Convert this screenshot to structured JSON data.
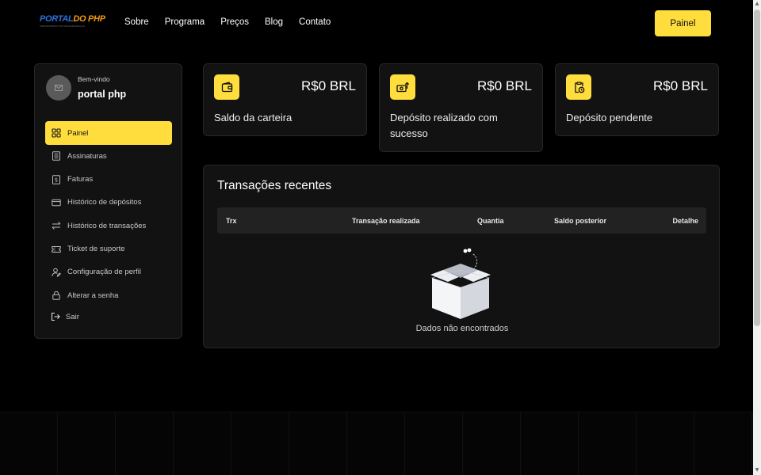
{
  "brand": {
    "logo_part1": "PORTAL",
    "logo_part2": "DO PHP",
    "logo_tagline": "TREINAMENTO EM PROGRAMAÇÃO"
  },
  "nav": {
    "items": [
      {
        "label": "Sobre"
      },
      {
        "label": "Programa"
      },
      {
        "label": "Preços"
      },
      {
        "label": "Blog"
      },
      {
        "label": "Contato"
      }
    ]
  },
  "header": {
    "cta_label": "Painel"
  },
  "user": {
    "welcome": "Bem-vindo",
    "name": "portal php"
  },
  "sidebar": {
    "items": [
      {
        "label": "Painel",
        "icon": "dashboard-icon",
        "active": true
      },
      {
        "label": "Assinaturas",
        "icon": "list-icon"
      },
      {
        "label": "Faturas",
        "icon": "invoice-icon"
      },
      {
        "label": "Histórico de depósitos",
        "icon": "card-icon"
      },
      {
        "label": "Histórico de transações",
        "icon": "transfer-icon"
      },
      {
        "label": "Ticket de suporte",
        "icon": "ticket-icon"
      },
      {
        "label": "Configuração de perfil",
        "icon": "user-edit-icon"
      },
      {
        "label": "Alterar a senha",
        "icon": "lock-icon"
      },
      {
        "label": "Sair",
        "icon": "logout-icon"
      }
    ]
  },
  "stats": [
    {
      "amount": "R$0 BRL",
      "label": "Saldo da carteira",
      "icon": "wallet-icon"
    },
    {
      "amount": "R$0 BRL",
      "label": "Depósito realizado com sucesso",
      "icon": "money-upload-icon"
    },
    {
      "amount": "R$0 BRL",
      "label": "Depósito pendente",
      "icon": "clock-clipboard-icon"
    }
  ],
  "transactions": {
    "title": "Transações recentes",
    "columns": [
      "Trx",
      "Transação realizada",
      "Quantia",
      "Saldo posterior",
      "Detalhe"
    ],
    "rows": [],
    "empty_text": "Dados não encontrados"
  },
  "colors": {
    "accent": "#ffdd3c",
    "background": "#000000",
    "card": "#121212"
  }
}
